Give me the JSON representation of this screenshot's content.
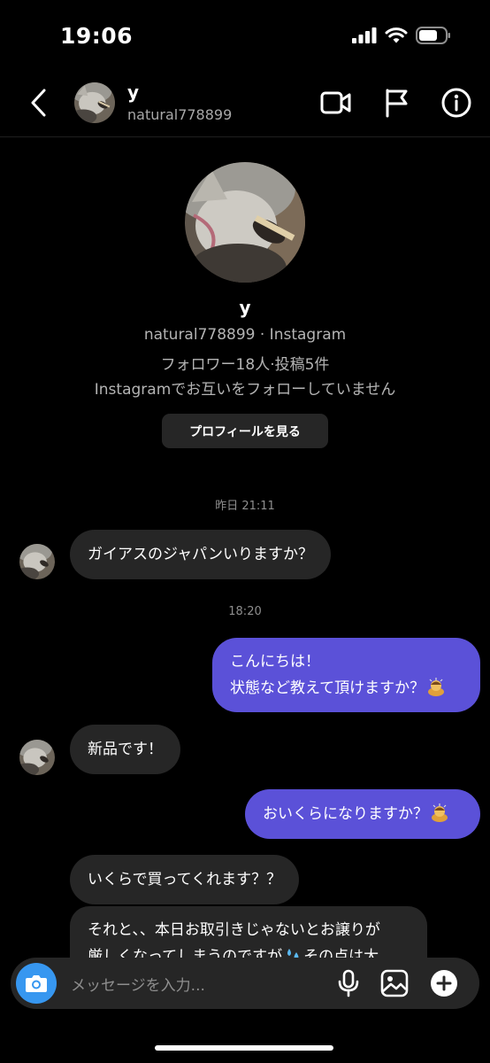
{
  "status_bar": {
    "time": "19:06"
  },
  "header": {
    "name": "y",
    "username": "natural778899"
  },
  "profile": {
    "name": "y",
    "line1": "natural778899 · Instagram",
    "line2": "フォロワー18人·投稿5件",
    "line3": "Instagramでお互いをフォローしていません",
    "view_profile_label": "プロフィールを見る"
  },
  "messages": {
    "ts1": "昨日 21:11",
    "m1": "ガイアスのジャパンいりますか？",
    "ts2": "18:20",
    "m2_line1": "こんにちは！",
    "m2_line2": "状態など教えて頂けますか？",
    "m3": "新品です！",
    "m4": "おいくらになりますか？",
    "m5": "いくらで買ってくれます？？",
    "m6_line1": "それと、、本日お取引きじゃないとお譲りが",
    "m6_line2a": "厳しくなってしまうのですが",
    "m6_line2b": "その点は大"
  },
  "input": {
    "placeholder": "メッセージを入力..."
  },
  "colors": {
    "sent_bubble": "#5b51d8",
    "recv_bubble": "#262626",
    "camera": "#3797f0"
  }
}
